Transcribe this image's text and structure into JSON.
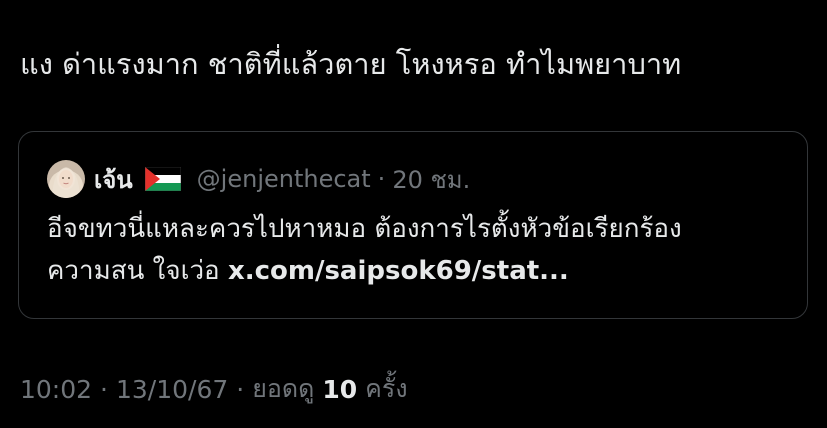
{
  "post": {
    "text": "แง ด่าแรงมาก ชาติที่แล้วตาย โหงหรอ ทำไมพยาบาท"
  },
  "quote": {
    "display_name": "เจ้น",
    "flag": "palestine-flag-icon",
    "handle": "@jenjenthecat",
    "separator": "·",
    "time": "20 ชม.",
    "body_line1": "อีจขทวนี่แหละควรไปหาหมอ ต้องการไรตั้งหัวข้อเรียกร้อง",
    "body_line2_prefix": "ความสน ใจเว่อ ",
    "link": "x.com/saipsok69/stat..."
  },
  "meta": {
    "time": "10:02",
    "sep1": "·",
    "date": "13/10/67",
    "sep2": "·",
    "views_label": "ยอดดู",
    "views_count": "10",
    "views_unit": "ครั้ง"
  },
  "colors": {
    "background": "#000000",
    "text": "#e7e9ea",
    "muted": "#71767b",
    "border": "#333639"
  }
}
